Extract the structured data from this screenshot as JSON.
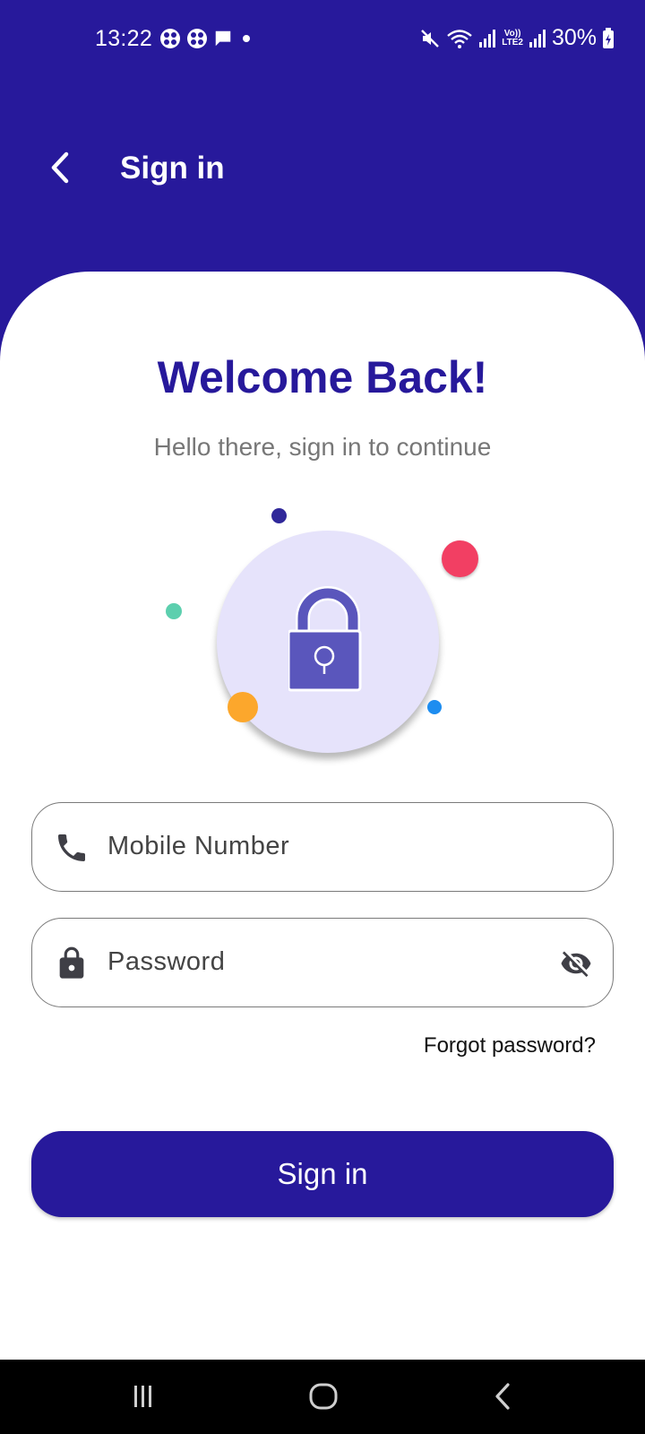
{
  "status_bar": {
    "time": "13:22",
    "battery": "30%",
    "network_badge_line1": "Vo))",
    "network_badge_line2": "LTE2",
    "icons": [
      "app-notification-icon",
      "app-notification-icon",
      "message-icon",
      "notification-dot-icon",
      "mute-icon",
      "wifi-icon",
      "signal-icon",
      "volte-icon",
      "signal-icon",
      "battery-charging-icon"
    ]
  },
  "app_bar": {
    "back_icon": "back-arrow-icon",
    "title": "Sign in"
  },
  "welcome": {
    "title": "Welcome Back!",
    "subtitle": "Hello there, sign in to continue"
  },
  "illustration": {
    "icon": "padlock-icon",
    "circle_color": "#e6e3fb",
    "lock_color": "#5a56bc",
    "dot_colors": [
      "#30289a",
      "#f23f63",
      "#5ccfae",
      "#fca72c",
      "#1d8df0"
    ]
  },
  "form": {
    "mobile": {
      "placeholder": "Mobile Number",
      "icon": "phone-icon"
    },
    "password": {
      "placeholder": "Password",
      "icon": "lock-icon",
      "toggle_icon": "eye-off-icon"
    },
    "forgot_password": "Forgot password?",
    "submit_label": "Sign in"
  },
  "nav_bar": {
    "buttons": [
      "recent-apps-icon",
      "home-icon",
      "back-icon"
    ]
  },
  "colors": {
    "primary": "#27199b",
    "background": "#ffffff",
    "subtitle": "#777777"
  }
}
